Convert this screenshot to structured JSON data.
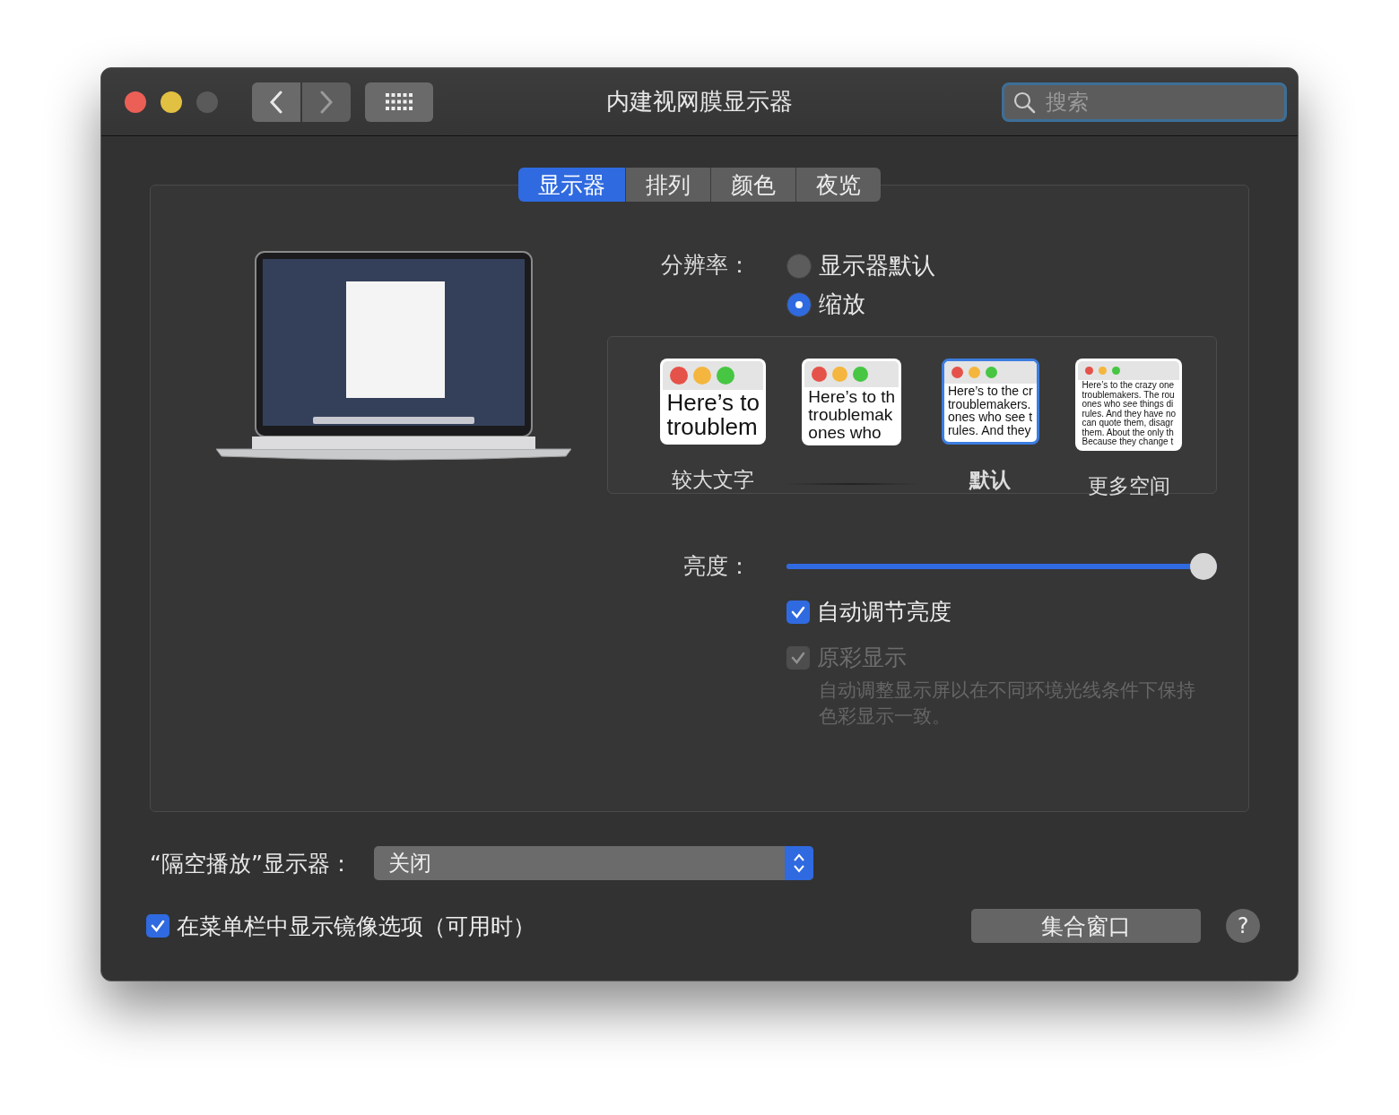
{
  "window": {
    "title": "内建视网膜显示器",
    "search_placeholder": "搜索"
  },
  "tabs": [
    {
      "label": "显示器",
      "selected": true
    },
    {
      "label": "排列",
      "selected": false
    },
    {
      "label": "颜色",
      "selected": false
    },
    {
      "label": "夜览",
      "selected": false
    }
  ],
  "resolution": {
    "label": "分辨率：",
    "options": [
      {
        "label": "显示器默认",
        "selected": false
      },
      {
        "label": "缩放",
        "selected": true
      }
    ],
    "scales": [
      {
        "label": "较大文字",
        "selected": false,
        "preview_lines": [
          "Here’s to",
          "troublem"
        ]
      },
      {
        "selected": false,
        "preview_lines": [
          "Here’s to th",
          "troublemak",
          "ones who"
        ]
      },
      {
        "label": "默认",
        "selected": true,
        "preview_lines": [
          "Here’s to the cr",
          "troublemakers.",
          "ones who see t",
          "rules. And they"
        ]
      },
      {
        "label": "更多空间",
        "selected": false,
        "preview_lines": [
          "Here’s to the crazy one",
          "troublemakers. The rou",
          "ones who see things di",
          "rules. And they have no",
          "can quote them, disagr",
          "them. About the only th",
          "Because they change t"
        ]
      }
    ]
  },
  "brightness": {
    "label": "亮度：",
    "level": 1
  },
  "checkboxes": [
    {
      "label": "自动调节亮度",
      "checked": true,
      "disabled": false
    },
    {
      "label": "原彩显示",
      "checked": true,
      "disabled": true,
      "description": "自动调整显示屏以在不同环境光线条件下保持色彩显示一致。"
    }
  ],
  "airplay": {
    "label": "“隔空播放”显示器：",
    "value": "关闭"
  },
  "mirror_option": {
    "label": "在菜单栏中显示镜像选项（可用时）",
    "checked": true
  },
  "gather_button": "集合窗口",
  "help_button": "?"
}
